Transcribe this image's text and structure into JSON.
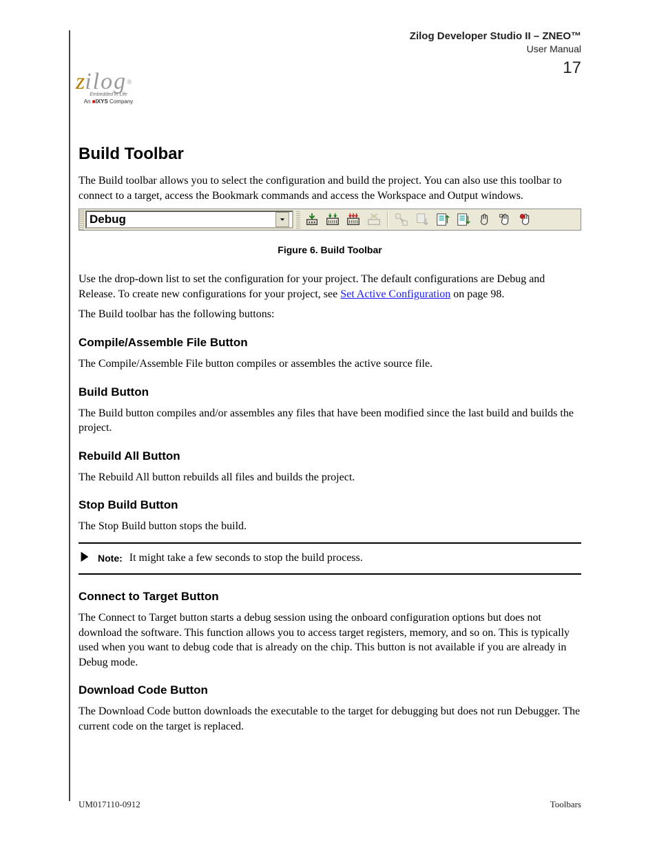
{
  "header": {
    "title": "Zilog Developer Studio II – ZNEO™",
    "subtitle": "User Manual",
    "page_number": "17"
  },
  "logo": {
    "brand_z": "z",
    "brand_rest": "ilog",
    "reg": "®",
    "tagline": "Embedded in Life",
    "company_prefix": "An",
    "company_brand": "IXYS",
    "company_suffix": "Company",
    "ixys_mark": "■"
  },
  "sections": {
    "build_title": "Build Toolbar",
    "build_para": "The Build toolbar allows you to select the configuration and build the project. You can also use this toolbar to connect to a target, access the Bookmark commands and access the Workspace and Output windows.",
    "figure_caption": "Figure 6. Build Toolbar",
    "build_desc_1": "Use the drop-down list to set the configuration for your project. The default configurations are Debug and Release. To create new configurations for your project, see ",
    "build_desc_link": "Set Active Configuration",
    "build_desc_2": " on page 98.",
    "buttons_intro": "The Build toolbar has the following buttons:",
    "btn_compile_t": "Compile/Assemble File Button",
    "btn_compile_b": "The Compile/Assemble File button compiles or assembles the active source file.",
    "btn_build_t": "Build Button",
    "btn_build_b": "The Build button compiles and/or assembles any files that have been modified since the last build and builds the project.",
    "btn_rebuild_t": "Rebuild All Button",
    "btn_rebuild_b": "The Rebuild All button rebuilds all files and builds the project.",
    "btn_stop_t": "Stop Build Button",
    "btn_stop_b": "The Stop Build button stops the build.",
    "note_label": "Note:",
    "note_text": "It might take a few seconds to stop the build process.",
    "btn_connect_t": "Connect to Target Button",
    "btn_connect_b": "The Connect to Target button starts a debug session using the onboard configuration options but does not download the software. This function allows you to access target registers, memory, and so on. This is typically used when you want to debug code that is already on the chip. This button is not available if you are already in Debug mode.",
    "btn_dlcode_t": "Download Code Button",
    "btn_dlcode_b": "The Download Code button downloads the executable to the target for debugging but does not run Debugger. The current code on the target is replaced."
  },
  "toolbar": {
    "dropdown_text": "Debug",
    "icons": [
      "compile-icon",
      "build-icon",
      "rebuild-icon",
      "stop-build-icon",
      "connect-icon",
      "download-icon",
      "bookmark-next-icon",
      "bookmark-prev-icon",
      "hand1-icon",
      "hand2-icon",
      "hand-dot-icon"
    ]
  },
  "footer": {
    "doc_id": "UM017110-0912",
    "section": "Toolbars"
  }
}
